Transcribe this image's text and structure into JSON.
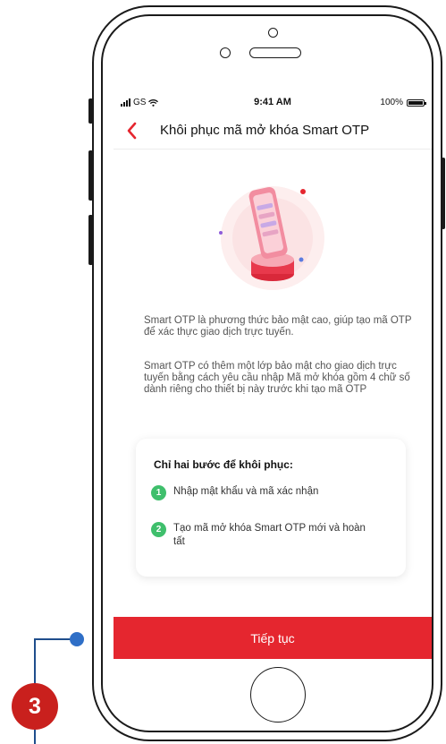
{
  "annotation": {
    "step_number": "3"
  },
  "statusbar": {
    "carrier": "GS",
    "time": "9:41 AM",
    "battery": "100%"
  },
  "navbar": {
    "title": "Khôi phục mã mở khóa Smart OTP"
  },
  "content": {
    "description_1": "Smart OTP là phương thức bảo mật cao, giúp tạo mã OTP để xác thực giao dịch trực tuyến.",
    "description_2": "Smart OTP có thêm một lớp bảo mật cho giao dịch trực tuyến bằng cách yêu cầu nhập Mã mở khóa gồm 4 chữ số dành riêng cho thiết bị này trước khi tạo mã OTP"
  },
  "steps_card": {
    "title": "Chỉ hai bước để khôi phục:",
    "steps": [
      {
        "number": "1",
        "text": "Nhập mật khẩu và mã xác nhận"
      },
      {
        "number": "2",
        "text": "Tạo mã mở khóa Smart OTP mới và hoàn tất"
      }
    ]
  },
  "cta": {
    "label": "Tiếp tục"
  },
  "colors": {
    "primary_red": "#e5262f",
    "step_green": "#3fbf6c",
    "annotation_red": "#c9201d",
    "annotation_blue": "#2f6fc7"
  }
}
